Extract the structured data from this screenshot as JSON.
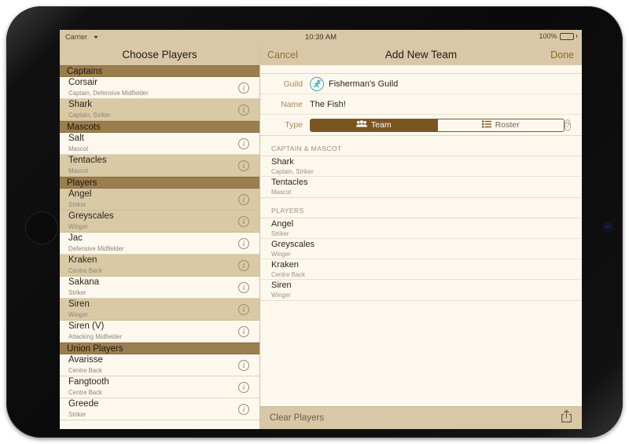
{
  "status_bar": {
    "carrier": "Carrier",
    "wifi_icon": "wifi-icon",
    "time": "10:39 AM",
    "battery_percent": "100%"
  },
  "master": {
    "title": "Choose Players",
    "sections": [
      {
        "header": "Captains",
        "rows": [
          {
            "name": "Corsair",
            "subtitle": "Captain, Defensive Midfielder",
            "selected": false
          },
          {
            "name": "Shark",
            "subtitle": "Captain, Striker",
            "selected": true
          }
        ]
      },
      {
        "header": "Mascots",
        "rows": [
          {
            "name": "Salt",
            "subtitle": "Mascot",
            "selected": false
          },
          {
            "name": "Tentacles",
            "subtitle": "Mascot",
            "selected": true
          }
        ]
      },
      {
        "header": "Players",
        "rows": [
          {
            "name": "Angel",
            "subtitle": "Striker",
            "selected": true
          },
          {
            "name": "Greyscales",
            "subtitle": "Winger",
            "selected": true
          },
          {
            "name": "Jac",
            "subtitle": "Defensive Midfielder",
            "selected": false
          },
          {
            "name": "Kraken",
            "subtitle": "Centre Back",
            "selected": true
          },
          {
            "name": "Sakana",
            "subtitle": "Striker",
            "selected": false
          },
          {
            "name": "Siren",
            "subtitle": "Winger",
            "selected": true
          },
          {
            "name": "Siren (V)",
            "subtitle": "Attacking Midfielder",
            "selected": false
          }
        ]
      },
      {
        "header": "Union Players",
        "rows": [
          {
            "name": "Avarisse",
            "subtitle": "Centre Back",
            "selected": false
          },
          {
            "name": "Fangtooth",
            "subtitle": "Centre Back",
            "selected": false
          },
          {
            "name": "Greede",
            "subtitle": "Striker",
            "selected": false
          }
        ]
      }
    ],
    "info_icon": "info-icon"
  },
  "detail": {
    "cancel_label": "Cancel",
    "title": "Add New Team",
    "done_label": "Done",
    "form": {
      "guild_label": "Guild",
      "guild_value": "Fisherman's Guild",
      "guild_icon": "guild-crest-icon",
      "name_label": "Name",
      "name_value": "The Fish!",
      "type_label": "Type",
      "segments": [
        {
          "label": "Team",
          "icon": "people-icon",
          "selected": true
        },
        {
          "label": "Roster",
          "icon": "list-icon",
          "selected": false
        }
      ],
      "help_label": "?"
    },
    "sections": [
      {
        "header": "CAPTAIN & MASCOT",
        "rows": [
          {
            "name": "Shark",
            "subtitle": "Captain, Striker"
          },
          {
            "name": "Tentacles",
            "subtitle": "Mascot"
          }
        ]
      },
      {
        "header": "PLAYERS",
        "rows": [
          {
            "name": "Angel",
            "subtitle": "Striker"
          },
          {
            "name": "Greyscales",
            "subtitle": "Winger"
          },
          {
            "name": "Kraken",
            "subtitle": "Centre Back"
          },
          {
            "name": "Siren",
            "subtitle": "Winger"
          }
        ]
      }
    ],
    "toolbar": {
      "clear_label": "Clear Players",
      "share_icon": "share-icon"
    }
  },
  "colors": {
    "nav_bar": "#d9c7a7",
    "section_header": "#9b7e4e",
    "selected_row": "#d9c9a5",
    "page_background": "#fdf8ee",
    "accent_brown": "#7a5522",
    "guild_teal": "#3fa8bd"
  }
}
